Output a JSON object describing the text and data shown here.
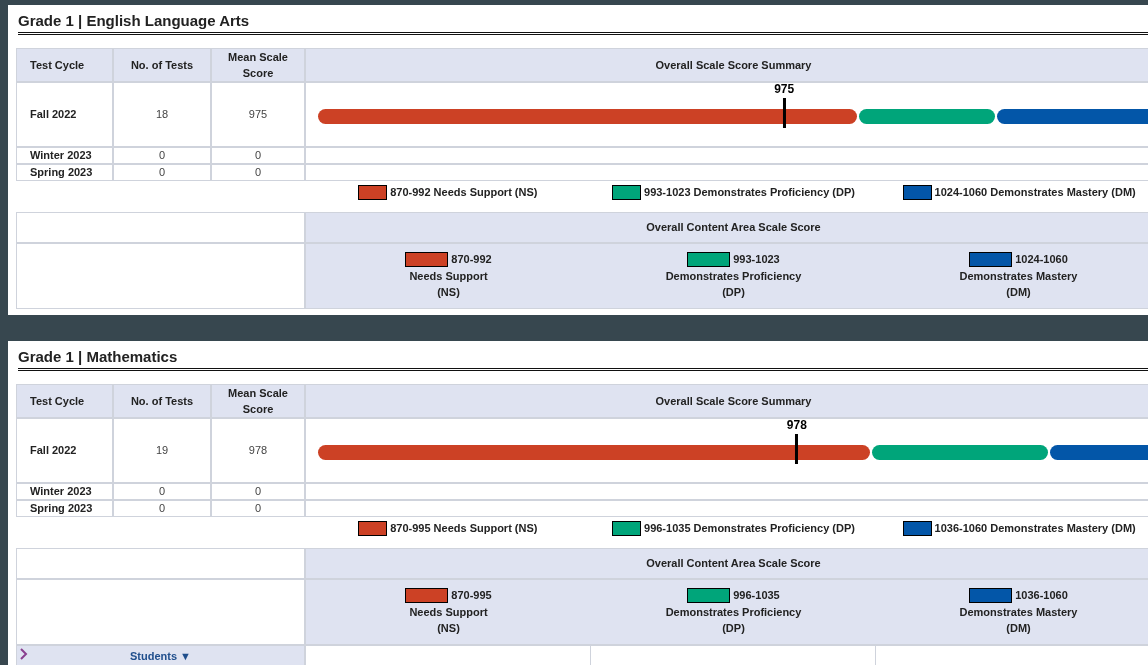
{
  "sections": [
    {
      "title": "Grade 1 | English Language Arts",
      "columns": [
        "Test Cycle",
        "No. of Tests",
        "Mean Scale Score",
        "Overall Scale Score Summary"
      ],
      "rows": [
        {
          "cycle": "Fall 2022",
          "tests": "18",
          "mean": "975",
          "marker": {
            "label": "975",
            "level": 0.553
          }
        },
        {
          "cycle": "Winter 2023",
          "tests": "0",
          "mean": "0"
        },
        {
          "cycle": "Spring 2023",
          "tests": "0",
          "mean": "0"
        }
      ],
      "bar": [
        {
          "color": "#cc4125"
        },
        {
          "color": "#00a57a"
        },
        {
          "color": "#0356a8"
        }
      ],
      "legend": [
        {
          "label": "870-992 Needs Support (NS)",
          "color": "#cc4125"
        },
        {
          "label": "993-1023 Demonstrates Proficiency (DP)",
          "color": "#00a57a"
        },
        {
          "label": "1024-1060 Demonstrates Mastery (DM)",
          "color": "#0356a8"
        }
      ],
      "content_area": {
        "title": "Overall Content Area Scale Score",
        "bands": [
          {
            "range": "870-992",
            "name": "Needs Support",
            "abbr": "(NS)",
            "color": "#cc4125"
          },
          {
            "range": "993-1023",
            "name": "Demonstrates Proficiency",
            "abbr": "(DP)",
            "color": "#00a57a"
          },
          {
            "range": "1024-1060",
            "name": "Demonstrates Mastery",
            "abbr": "(DM)",
            "color": "#0356a8"
          }
        ]
      }
    },
    {
      "title": "Grade 1 | Mathematics",
      "columns": [
        "Test Cycle",
        "No. of Tests",
        "Mean Scale Score",
        "Overall Scale Score Summary"
      ],
      "rows": [
        {
          "cycle": "Fall 2022",
          "tests": "19",
          "mean": "978",
          "marker": {
            "label": "978",
            "level": 0.568
          }
        },
        {
          "cycle": "Winter 2023",
          "tests": "0",
          "mean": "0"
        },
        {
          "cycle": "Spring 2023",
          "tests": "0",
          "mean": "0"
        }
      ],
      "bar": [
        {
          "color": "#cc4125"
        },
        {
          "color": "#00a57a"
        },
        {
          "color": "#0356a8"
        }
      ],
      "legend": [
        {
          "label": "870-995 Needs Support (NS)",
          "color": "#cc4125"
        },
        {
          "label": "996-1035 Demonstrates Proficiency (DP)",
          "color": "#00a57a"
        },
        {
          "label": "1036-1060 Demonstrates Mastery (DM)",
          "color": "#0356a8"
        }
      ],
      "content_area": {
        "title": "Overall Content Area Scale Score",
        "bands": [
          {
            "range": "870-995",
            "name": "Needs Support",
            "abbr": "(NS)",
            "color": "#cc4125"
          },
          {
            "range": "996-1035",
            "name": "Demonstrates Proficiency",
            "abbr": "(DP)",
            "color": "#00a57a"
          },
          {
            "range": "1036-1060",
            "name": "Demonstrates Mastery",
            "abbr": "(DM)",
            "color": "#0356a8"
          }
        ]
      },
      "expand_row": {
        "label": "Students ▼"
      }
    }
  ]
}
